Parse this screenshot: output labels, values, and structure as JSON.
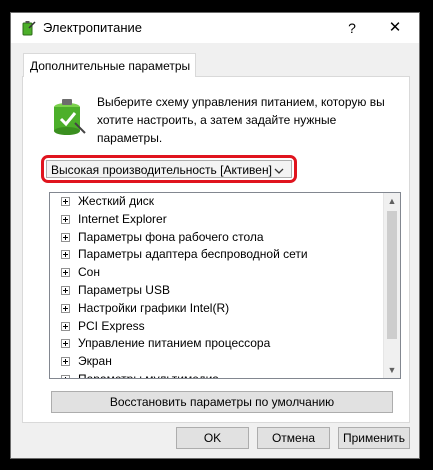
{
  "window": {
    "title": "Электропитание",
    "help_glyph": "?",
    "close_glyph": "✕"
  },
  "tab": {
    "label": "Дополнительные параметры"
  },
  "description": "Выберите схему управления питанием, которую вы хотите настроить, а затем задайте нужные параметры.",
  "plan_select": {
    "value": "Высокая производительность [Активен]"
  },
  "tree": {
    "items": [
      "Жесткий диск",
      "Internet Explorer",
      "Параметры фона рабочего стола",
      "Параметры адаптера беспроводной сети",
      "Сон",
      "Параметры USB",
      "Настройки графики Intel(R)",
      "PCI Express",
      "Управление питанием процессора",
      "Экран",
      "Параметры мультимедиа"
    ]
  },
  "restore_button": "Восстановить параметры по умолчанию",
  "buttons": {
    "ok": "OK",
    "cancel": "Отмена",
    "apply": "Применить"
  },
  "icons": {
    "app": "power-battery-icon",
    "battery": "battery-checkmark-icon",
    "chevron": "chevron-down-icon",
    "expander": "plus-box-icon",
    "scroll_up": "triangle-up-icon",
    "scroll_down": "triangle-down-icon"
  },
  "colors": {
    "highlight": "#e0141e",
    "battery_green": "#4caf2a"
  }
}
